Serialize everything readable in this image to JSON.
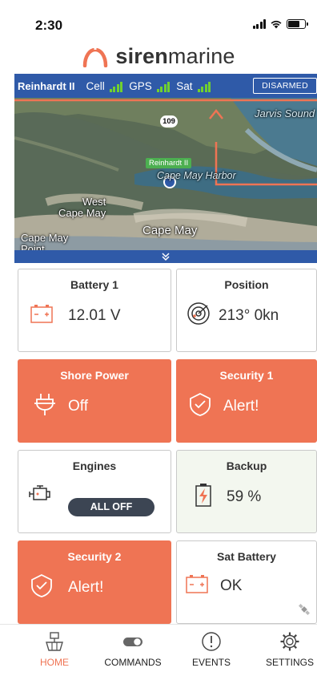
{
  "status_bar": {
    "time": "2:30"
  },
  "brand": {
    "bold": "siren",
    "regular": "marine"
  },
  "vessel": {
    "name": "Reinhardt II",
    "signals": [
      {
        "label": "Cell",
        "bars": 3
      },
      {
        "label": "GPS",
        "bars": 3
      },
      {
        "label": "Sat",
        "bars": 3
      }
    ],
    "arm_status": "DISARMED"
  },
  "map": {
    "labels": {
      "jarvis": "Jarvis Sound",
      "route": "109",
      "marker": "Reinhardt II",
      "harbor": "Cape May Harbor",
      "west_cape_may": "West\nCape May",
      "cape_may": "Cape May",
      "cape_may_point": "Cape May\nPoint"
    },
    "collapse_icon": "chevron-double-down-icon"
  },
  "tiles": {
    "battery1": {
      "title": "Battery 1",
      "value": "12.01 V",
      "icon": "battery-icon"
    },
    "position": {
      "title": "Position",
      "value": "213° 0kn",
      "icon": "radar-icon"
    },
    "shore_power": {
      "title": "Shore Power",
      "value": "Off",
      "icon": "plug-icon"
    },
    "security1": {
      "title": "Security 1",
      "value": "Alert!",
      "icon": "shield-check-icon"
    },
    "engines": {
      "title": "Engines",
      "value": "ALL OFF",
      "icon": "engine-icon"
    },
    "backup": {
      "title": "Backup",
      "value": "59 %",
      "icon": "charging-battery-icon"
    },
    "security2": {
      "title": "Security 2",
      "value": "Alert!",
      "icon": "shield-check-icon"
    },
    "sat_battery": {
      "title": "Sat Battery",
      "value": "OK",
      "icon": "battery-icon"
    }
  },
  "nav": {
    "items": [
      {
        "label": "HOME",
        "icon": "boat-icon",
        "active": true
      },
      {
        "label": "COMMANDS",
        "icon": "toggle-icon",
        "active": false
      },
      {
        "label": "EVENTS",
        "icon": "alert-circle-icon",
        "active": false
      },
      {
        "label": "SETTINGS",
        "icon": "gear-icon",
        "active": false
      }
    ]
  },
  "colors": {
    "accent": "#ef7454",
    "vessel_bar": "#2f5aa8",
    "signal_green": "#71d12e",
    "pill": "#3c4553"
  }
}
